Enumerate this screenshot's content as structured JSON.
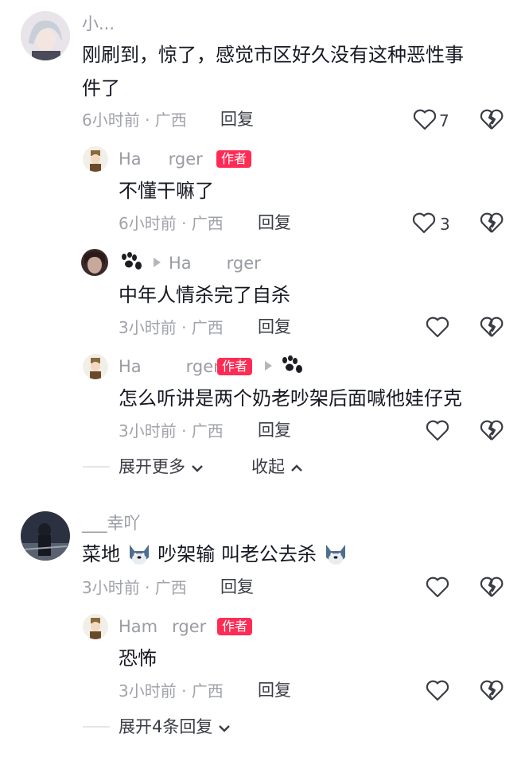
{
  "comments": [
    {
      "username": "小...",
      "text_line1": "刚刷到，惊了，感觉市区好久没有这种恶性事",
      "text_line2": "件了",
      "meta": "6小时前 · 广西",
      "reply_label": "回复",
      "like_count": "7"
    },
    {
      "username": "___幸吖",
      "text_part1": "菜地",
      "text_part2": "吵架输  叫老公去杀",
      "meta": "3小时前 · 广西",
      "reply_label": "回复"
    }
  ],
  "replies": [
    {
      "username_pre": "Ha",
      "username_post": "rger",
      "badge": "作者",
      "text": "不懂干嘛了",
      "meta": "6小时前 · 广西",
      "reply_label": "回复",
      "like_count": "3"
    },
    {
      "username_pre": "Ha",
      "username_post": "rger",
      "text": "中年人情杀完了自杀",
      "meta": "3小时前 · 广西",
      "reply_label": "回复"
    },
    {
      "username_pre": "Ha",
      "username_post": "rger",
      "badge": "作者",
      "text": "怎么听讲是两个奶老吵架后面喊他娃仔克",
      "meta": "3小时前 · 广西",
      "reply_label": "回复"
    },
    {
      "username_pre": "Ham",
      "username_post": "rger",
      "badge": "作者",
      "text": "恐怖",
      "meta": "3小时前 · 广西",
      "reply_label": "回复"
    }
  ],
  "thread1": {
    "expand_more": "展开更多",
    "collapse": "收起"
  },
  "thread2": {
    "expand_replies": "展开4条回复"
  },
  "colors": {
    "author_badge": "#fe2c55",
    "meta_text": "#a1a3aa",
    "name_text": "#9a9ca3"
  }
}
